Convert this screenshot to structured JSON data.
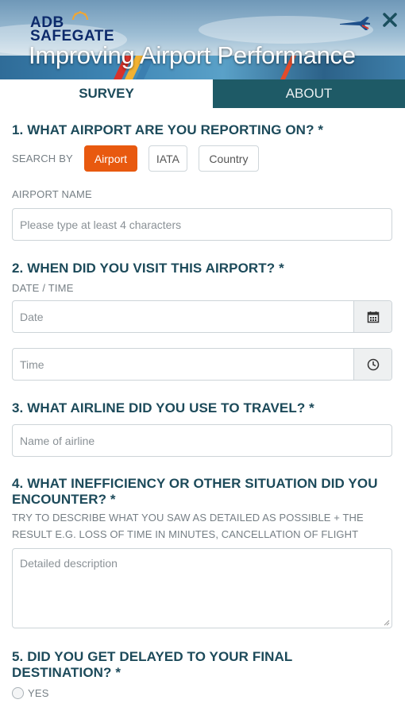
{
  "header": {
    "logo_line1": "ADB",
    "logo_line2": "SAFEGATE",
    "banner_title": "Improving Airport Performance",
    "icons": {
      "plane": "airplane-icon",
      "close": "close-icon"
    },
    "colors": {
      "logo": "#0d2a6b",
      "stripes": [
        "#d7322b",
        "#f2b233"
      ]
    }
  },
  "tabs": [
    {
      "label": "SURVEY",
      "active": true
    },
    {
      "label": "ABOUT",
      "active": false
    }
  ],
  "q1": {
    "title": "1. WHAT AIRPORT ARE YOU REPORTING ON? *",
    "search_by_label": "SEARCH BY",
    "options": [
      {
        "label": "Airport",
        "selected": true
      },
      {
        "label": "IATA",
        "selected": false
      },
      {
        "label": "Country",
        "selected": false
      }
    ],
    "field_label": "AIRPORT NAME",
    "placeholder": "Please type at least 4 characters"
  },
  "q2": {
    "title": "2. WHEN DID YOU VISIT THIS AIRPORT? *",
    "field_label": "DATE / TIME",
    "date_placeholder": "Date",
    "time_placeholder": "Time",
    "icons": {
      "date": "calendar-icon",
      "time": "clock-icon"
    }
  },
  "q3": {
    "title": "3. WHAT AIRLINE DID YOU USE TO TRAVEL? *",
    "placeholder": "Name of airline"
  },
  "q4": {
    "title_line1": "4. WHAT INEFFICIENCY OR OTHER SITUATION DID YOU",
    "title_line2": "ENCOUNTER? *",
    "hint_line1": "TRY TO DESCRIBE WHAT YOU SAW AS DETAILED AS POSSIBLE + THE",
    "hint_line2": "RESULT E.G. LOSS OF TIME IN MINUTES, CANCELLATION OF FLIGHT",
    "placeholder": "Detailed description"
  },
  "q5": {
    "title_line1": "5. DID YOU GET DELAYED TO YOUR FINAL",
    "title_line2": "DESTINATION? *",
    "option_yes": "YES"
  },
  "accent_color": "#e8590f",
  "tab_active_bg": "#ffffff",
  "tab_inactive_bg": "#1e5a66"
}
